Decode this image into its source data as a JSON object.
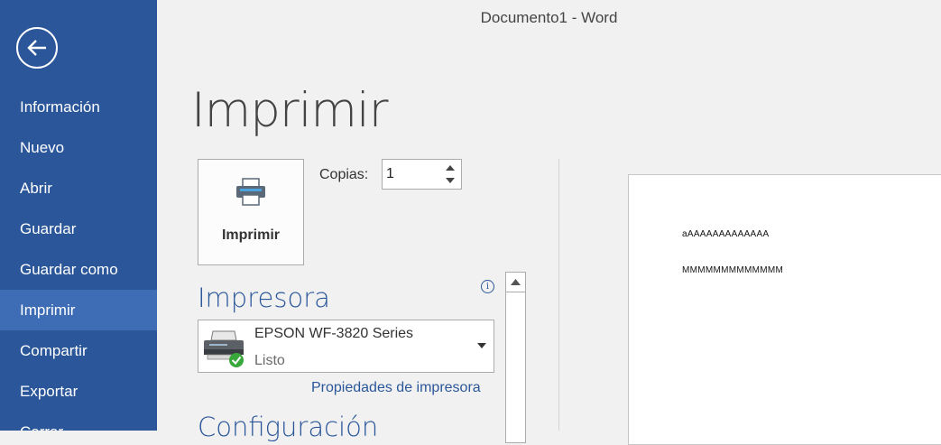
{
  "window": {
    "title": "Documento1 - Word"
  },
  "sidebar": {
    "back_icon": "arrow-left-icon",
    "items": [
      {
        "label": "Información"
      },
      {
        "label": "Nuevo"
      },
      {
        "label": "Abrir"
      },
      {
        "label": "Guardar"
      },
      {
        "label": "Guardar como"
      },
      {
        "label": "Imprimir",
        "active": true
      },
      {
        "label": "Compartir"
      },
      {
        "label": "Exportar"
      },
      {
        "label": "Cerrar"
      }
    ]
  },
  "print": {
    "heading": "Imprimir",
    "print_button": {
      "label": "Imprimir",
      "icon": "printer-icon"
    },
    "copies": {
      "label": "Copias:",
      "value": "1"
    },
    "printer_section": {
      "heading": "Impresora",
      "info_icon": "info-icon",
      "selected_printer": {
        "name": "EPSON WF-3820 Series",
        "status": "Listo",
        "icon": "printer-ready-icon"
      },
      "properties_link": "Propiedades de impresora"
    },
    "settings_section": {
      "heading": "Configuración"
    }
  },
  "preview": {
    "lines": [
      "aAAAAAAAAAAAAA",
      "MMMMMMMMMMMMM"
    ]
  },
  "colors": {
    "sidebar_bg": "#2b579a",
    "sidebar_active": "#3e6db5",
    "accent": "#2b579a",
    "backstage_bg": "#f1f1f1"
  }
}
